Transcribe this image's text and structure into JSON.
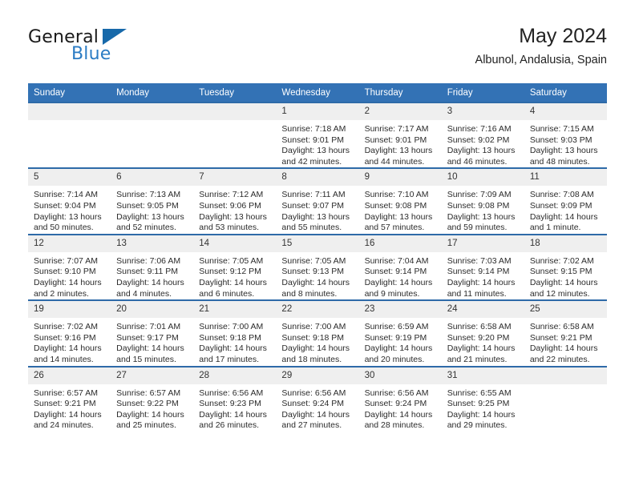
{
  "brand": {
    "name_primary": "General",
    "name_secondary": "Blue",
    "accent_color": "#2b7cc4",
    "triangle_color": "#1769aa"
  },
  "header": {
    "title": "May 2024",
    "subtitle": "Albunol, Andalusia, Spain"
  },
  "theme": {
    "header_row_bg": "#3372b5",
    "daynum_bg": "#efefef",
    "cell_border": "#2e6aa8"
  },
  "weekday_headers": [
    "Sunday",
    "Monday",
    "Tuesday",
    "Wednesday",
    "Thursday",
    "Friday",
    "Saturday"
  ],
  "labels": {
    "sunrise_prefix": "Sunrise:",
    "sunset_prefix": "Sunset:",
    "daylight_prefix": "Daylight:"
  },
  "weeks": [
    [
      {
        "day": "",
        "sunrise": "",
        "sunset": "",
        "daylight_1": "",
        "daylight_2": "",
        "empty": true
      },
      {
        "day": "",
        "sunrise": "",
        "sunset": "",
        "daylight_1": "",
        "daylight_2": "",
        "empty": true
      },
      {
        "day": "",
        "sunrise": "",
        "sunset": "",
        "daylight_1": "",
        "daylight_2": "",
        "empty": true
      },
      {
        "day": "1",
        "sunrise": "Sunrise: 7:18 AM",
        "sunset": "Sunset: 9:01 PM",
        "daylight_1": "Daylight: 13 hours",
        "daylight_2": "and 42 minutes.",
        "empty": false
      },
      {
        "day": "2",
        "sunrise": "Sunrise: 7:17 AM",
        "sunset": "Sunset: 9:01 PM",
        "daylight_1": "Daylight: 13 hours",
        "daylight_2": "and 44 minutes.",
        "empty": false
      },
      {
        "day": "3",
        "sunrise": "Sunrise: 7:16 AM",
        "sunset": "Sunset: 9:02 PM",
        "daylight_1": "Daylight: 13 hours",
        "daylight_2": "and 46 minutes.",
        "empty": false
      },
      {
        "day": "4",
        "sunrise": "Sunrise: 7:15 AM",
        "sunset": "Sunset: 9:03 PM",
        "daylight_1": "Daylight: 13 hours",
        "daylight_2": "and 48 minutes.",
        "empty": false
      }
    ],
    [
      {
        "day": "5",
        "sunrise": "Sunrise: 7:14 AM",
        "sunset": "Sunset: 9:04 PM",
        "daylight_1": "Daylight: 13 hours",
        "daylight_2": "and 50 minutes.",
        "empty": false
      },
      {
        "day": "6",
        "sunrise": "Sunrise: 7:13 AM",
        "sunset": "Sunset: 9:05 PM",
        "daylight_1": "Daylight: 13 hours",
        "daylight_2": "and 52 minutes.",
        "empty": false
      },
      {
        "day": "7",
        "sunrise": "Sunrise: 7:12 AM",
        "sunset": "Sunset: 9:06 PM",
        "daylight_1": "Daylight: 13 hours",
        "daylight_2": "and 53 minutes.",
        "empty": false
      },
      {
        "day": "8",
        "sunrise": "Sunrise: 7:11 AM",
        "sunset": "Sunset: 9:07 PM",
        "daylight_1": "Daylight: 13 hours",
        "daylight_2": "and 55 minutes.",
        "empty": false
      },
      {
        "day": "9",
        "sunrise": "Sunrise: 7:10 AM",
        "sunset": "Sunset: 9:08 PM",
        "daylight_1": "Daylight: 13 hours",
        "daylight_2": "and 57 minutes.",
        "empty": false
      },
      {
        "day": "10",
        "sunrise": "Sunrise: 7:09 AM",
        "sunset": "Sunset: 9:08 PM",
        "daylight_1": "Daylight: 13 hours",
        "daylight_2": "and 59 minutes.",
        "empty": false
      },
      {
        "day": "11",
        "sunrise": "Sunrise: 7:08 AM",
        "sunset": "Sunset: 9:09 PM",
        "daylight_1": "Daylight: 14 hours",
        "daylight_2": "and 1 minute.",
        "empty": false
      }
    ],
    [
      {
        "day": "12",
        "sunrise": "Sunrise: 7:07 AM",
        "sunset": "Sunset: 9:10 PM",
        "daylight_1": "Daylight: 14 hours",
        "daylight_2": "and 2 minutes.",
        "empty": false
      },
      {
        "day": "13",
        "sunrise": "Sunrise: 7:06 AM",
        "sunset": "Sunset: 9:11 PM",
        "daylight_1": "Daylight: 14 hours",
        "daylight_2": "and 4 minutes.",
        "empty": false
      },
      {
        "day": "14",
        "sunrise": "Sunrise: 7:05 AM",
        "sunset": "Sunset: 9:12 PM",
        "daylight_1": "Daylight: 14 hours",
        "daylight_2": "and 6 minutes.",
        "empty": false
      },
      {
        "day": "15",
        "sunrise": "Sunrise: 7:05 AM",
        "sunset": "Sunset: 9:13 PM",
        "daylight_1": "Daylight: 14 hours",
        "daylight_2": "and 8 minutes.",
        "empty": false
      },
      {
        "day": "16",
        "sunrise": "Sunrise: 7:04 AM",
        "sunset": "Sunset: 9:14 PM",
        "daylight_1": "Daylight: 14 hours",
        "daylight_2": "and 9 minutes.",
        "empty": false
      },
      {
        "day": "17",
        "sunrise": "Sunrise: 7:03 AM",
        "sunset": "Sunset: 9:14 PM",
        "daylight_1": "Daylight: 14 hours",
        "daylight_2": "and 11 minutes.",
        "empty": false
      },
      {
        "day": "18",
        "sunrise": "Sunrise: 7:02 AM",
        "sunset": "Sunset: 9:15 PM",
        "daylight_1": "Daylight: 14 hours",
        "daylight_2": "and 12 minutes.",
        "empty": false
      }
    ],
    [
      {
        "day": "19",
        "sunrise": "Sunrise: 7:02 AM",
        "sunset": "Sunset: 9:16 PM",
        "daylight_1": "Daylight: 14 hours",
        "daylight_2": "and 14 minutes.",
        "empty": false
      },
      {
        "day": "20",
        "sunrise": "Sunrise: 7:01 AM",
        "sunset": "Sunset: 9:17 PM",
        "daylight_1": "Daylight: 14 hours",
        "daylight_2": "and 15 minutes.",
        "empty": false
      },
      {
        "day": "21",
        "sunrise": "Sunrise: 7:00 AM",
        "sunset": "Sunset: 9:18 PM",
        "daylight_1": "Daylight: 14 hours",
        "daylight_2": "and 17 minutes.",
        "empty": false
      },
      {
        "day": "22",
        "sunrise": "Sunrise: 7:00 AM",
        "sunset": "Sunset: 9:18 PM",
        "daylight_1": "Daylight: 14 hours",
        "daylight_2": "and 18 minutes.",
        "empty": false
      },
      {
        "day": "23",
        "sunrise": "Sunrise: 6:59 AM",
        "sunset": "Sunset: 9:19 PM",
        "daylight_1": "Daylight: 14 hours",
        "daylight_2": "and 20 minutes.",
        "empty": false
      },
      {
        "day": "24",
        "sunrise": "Sunrise: 6:58 AM",
        "sunset": "Sunset: 9:20 PM",
        "daylight_1": "Daylight: 14 hours",
        "daylight_2": "and 21 minutes.",
        "empty": false
      },
      {
        "day": "25",
        "sunrise": "Sunrise: 6:58 AM",
        "sunset": "Sunset: 9:21 PM",
        "daylight_1": "Daylight: 14 hours",
        "daylight_2": "and 22 minutes.",
        "empty": false
      }
    ],
    [
      {
        "day": "26",
        "sunrise": "Sunrise: 6:57 AM",
        "sunset": "Sunset: 9:21 PM",
        "daylight_1": "Daylight: 14 hours",
        "daylight_2": "and 24 minutes.",
        "empty": false
      },
      {
        "day": "27",
        "sunrise": "Sunrise: 6:57 AM",
        "sunset": "Sunset: 9:22 PM",
        "daylight_1": "Daylight: 14 hours",
        "daylight_2": "and 25 minutes.",
        "empty": false
      },
      {
        "day": "28",
        "sunrise": "Sunrise: 6:56 AM",
        "sunset": "Sunset: 9:23 PM",
        "daylight_1": "Daylight: 14 hours",
        "daylight_2": "and 26 minutes.",
        "empty": false
      },
      {
        "day": "29",
        "sunrise": "Sunrise: 6:56 AM",
        "sunset": "Sunset: 9:24 PM",
        "daylight_1": "Daylight: 14 hours",
        "daylight_2": "and 27 minutes.",
        "empty": false
      },
      {
        "day": "30",
        "sunrise": "Sunrise: 6:56 AM",
        "sunset": "Sunset: 9:24 PM",
        "daylight_1": "Daylight: 14 hours",
        "daylight_2": "and 28 minutes.",
        "empty": false
      },
      {
        "day": "31",
        "sunrise": "Sunrise: 6:55 AM",
        "sunset": "Sunset: 9:25 PM",
        "daylight_1": "Daylight: 14 hours",
        "daylight_2": "and 29 minutes.",
        "empty": false
      },
      {
        "day": "",
        "sunrise": "",
        "sunset": "",
        "daylight_1": "",
        "daylight_2": "",
        "empty": true
      }
    ]
  ]
}
